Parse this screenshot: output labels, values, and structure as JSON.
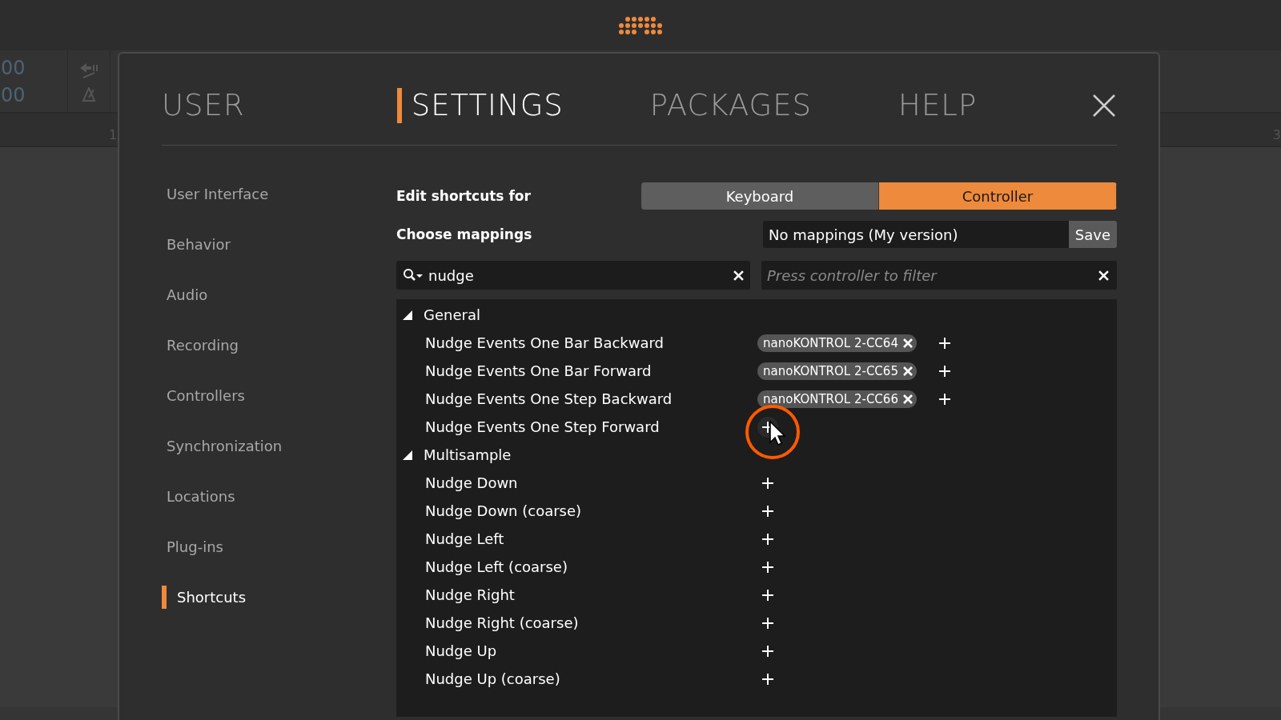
{
  "background": {
    "toolbar_readouts": [
      "00",
      "00"
    ],
    "ruler_labels": [
      "1",
      "3"
    ]
  },
  "tabs": [
    {
      "label": "USER",
      "selected": false
    },
    {
      "label": "SETTINGS",
      "selected": true
    },
    {
      "label": "PACKAGES",
      "selected": false
    },
    {
      "label": "HELP",
      "selected": false
    }
  ],
  "sidebar": {
    "items": [
      {
        "label": "User Interface",
        "selected": false
      },
      {
        "label": "Behavior",
        "selected": false
      },
      {
        "label": "Audio",
        "selected": false
      },
      {
        "label": "Recording",
        "selected": false
      },
      {
        "label": "Controllers",
        "selected": false
      },
      {
        "label": "Synchronization",
        "selected": false
      },
      {
        "label": "Locations",
        "selected": false
      },
      {
        "label": "Plug-ins",
        "selected": false
      },
      {
        "label": "Shortcuts",
        "selected": true
      }
    ]
  },
  "edit_shortcuts": {
    "label": "Edit shortcuts for",
    "options": [
      {
        "label": "Keyboard",
        "selected": false
      },
      {
        "label": "Controller",
        "selected": true
      }
    ]
  },
  "mappings": {
    "label": "Choose mappings",
    "value": "No mappings (My version)",
    "save_button": "Save"
  },
  "search": {
    "value": "nudge"
  },
  "controller_filter": {
    "placeholder": "Press controller to filter"
  },
  "groups": [
    {
      "label": "General",
      "expanded": true,
      "children": [
        {
          "label": "Nudge Events One Bar Backward",
          "hovered": false,
          "mappings": [
            "nanoKONTROL 2-CC64"
          ]
        },
        {
          "label": "Nudge Events One Bar Forward",
          "hovered": false,
          "mappings": [
            "nanoKONTROL 2-CC65"
          ]
        },
        {
          "label": "Nudge Events One Step Backward",
          "hovered": false,
          "mappings": [
            "nanoKONTROL 2-CC66"
          ]
        },
        {
          "label": "Nudge Events One Step Forward",
          "hovered": true
        }
      ]
    },
    {
      "label": "Multisample",
      "expanded": true,
      "children": [
        {
          "label": "Nudge Down",
          "hovered": false
        },
        {
          "label": "Nudge Down (coarse)",
          "hovered": false
        },
        {
          "label": "Nudge Left",
          "hovered": false
        },
        {
          "label": "Nudge Left (coarse)",
          "hovered": false
        },
        {
          "label": "Nudge Right",
          "hovered": false
        },
        {
          "label": "Nudge Right (coarse)",
          "hovered": false
        },
        {
          "label": "Nudge Up",
          "hovered": false
        },
        {
          "label": "Nudge Up (coarse)",
          "hovered": false
        }
      ]
    }
  ]
}
